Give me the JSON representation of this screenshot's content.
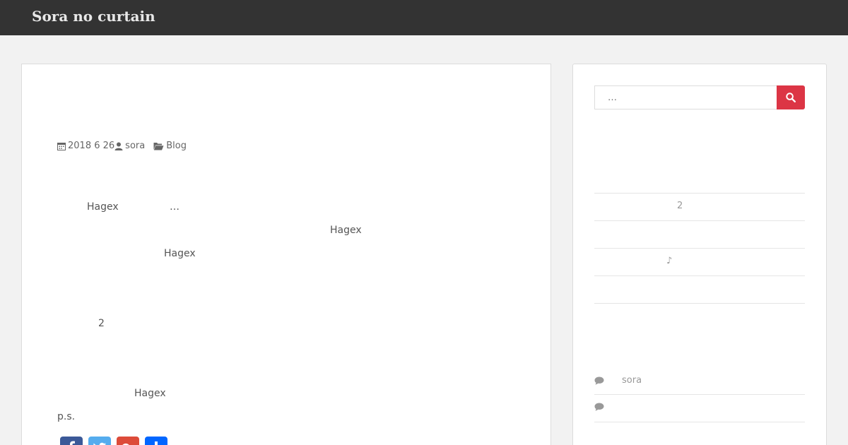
{
  "header": {
    "site_title": "Sora no curtain"
  },
  "post": {
    "meta": {
      "date": "2018 6 26",
      "author": "sora",
      "category": "Blog"
    },
    "lines": [
      {
        "t1": "Hagex",
        "t2": "…"
      },
      {
        "t1": "Hagex"
      },
      {
        "t1": "Hagex"
      },
      {
        "t1": "2"
      },
      {
        "t1": "Hagex"
      },
      {
        "t1": "p.s."
      }
    ],
    "share": [
      "facebook",
      "twitter",
      "google-plus",
      "share"
    ]
  },
  "sidebar": {
    "search": {
      "placeholder": "…"
    },
    "recent_posts": [
      {
        "label": "2"
      },
      {
        "label": ""
      },
      {
        "label": "♪"
      },
      {
        "label": ""
      }
    ],
    "recent_comments": [
      {
        "author": "sora"
      },
      {
        "author": ""
      }
    ]
  },
  "colors": {
    "header_bg": "#333333",
    "search_button": "#dc3545"
  }
}
